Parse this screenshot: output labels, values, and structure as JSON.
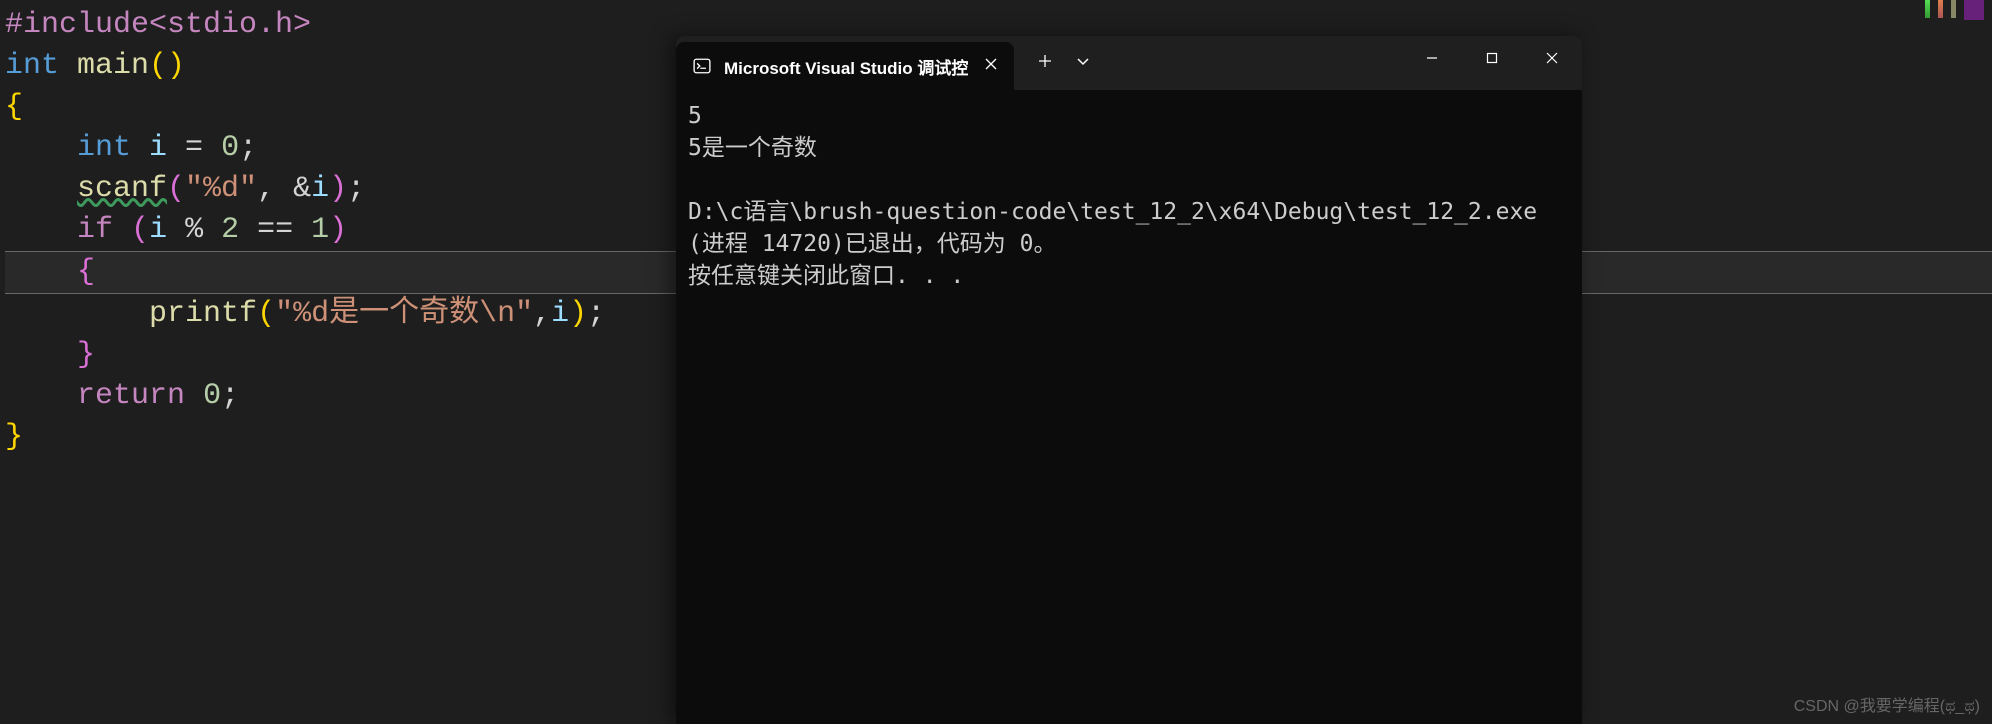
{
  "editor": {
    "line1": {
      "directive": "#include",
      "lib": "<stdio.h>"
    },
    "line2": {
      "type": "int ",
      "func": "main",
      "parens": "()"
    },
    "line3": "{",
    "line4": {
      "indent": "    ",
      "type": "int",
      "var": " i ",
      "eq": "= ",
      "num": "0",
      "semi": ";"
    },
    "line5": {
      "indent": "    ",
      "func": "scanf",
      "open": "(",
      "str": "\"%d\"",
      "comma": ", ",
      "amp": "&",
      "var": "i",
      "close": ")",
      "semi": ";"
    },
    "line6": {
      "indent": "    ",
      "kw": "if",
      "space": " ",
      "open": "(",
      "var": "i",
      "mod": " % ",
      "two": "2",
      "eq": " == ",
      "one": "1",
      "close": ")"
    },
    "line7": {
      "indent": "    ",
      "brace": "{"
    },
    "line8": {
      "indent": "        ",
      "func": "printf",
      "open": "(",
      "str": "\"%d是一个奇数\\n\"",
      "comma": ",",
      "var": "i",
      "close": ")",
      "semi": ";"
    },
    "line9": {
      "indent": "    ",
      "brace": "}"
    },
    "line10": {
      "indent": "    ",
      "kw": "return",
      "space": " ",
      "num": "0",
      "semi": ";"
    },
    "line11": "}"
  },
  "terminal": {
    "tab_title": "Microsoft Visual Studio 调试控",
    "output": "5\n5是一个奇数\n\nD:\\c语言\\brush-question-code\\test_12_2\\x64\\Debug\\test_12_2.exe (进程 14720)已退出，代码为 0。\n按任意键关闭此窗口. . ."
  },
  "watermark": "CSDN @我要学编程(ಥ_ಥ)"
}
